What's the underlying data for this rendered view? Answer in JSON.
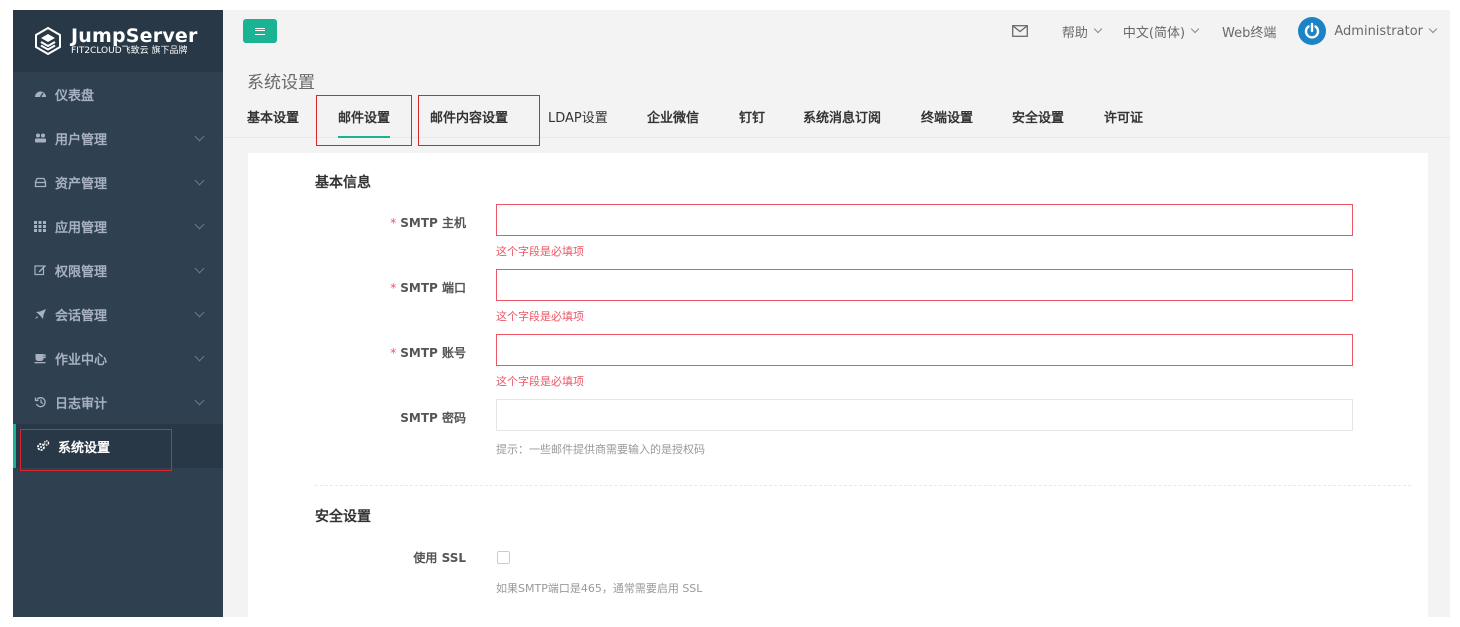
{
  "app": {
    "logo_title": "JumpServer",
    "logo_subtitle": "FIT2CLOUD飞致云 旗下品牌",
    "accent_color": "#1ab394",
    "sidebar_color": "#2f4050"
  },
  "sidebar": {
    "items": [
      {
        "label": "仪表盘",
        "icon": "dashboard-icon",
        "has_children": false
      },
      {
        "label": "用户管理",
        "icon": "users-icon",
        "has_children": true
      },
      {
        "label": "资产管理",
        "icon": "inbox-icon",
        "has_children": true
      },
      {
        "label": "应用管理",
        "icon": "grid-icon",
        "has_children": true
      },
      {
        "label": "权限管理",
        "icon": "edit-icon",
        "has_children": true
      },
      {
        "label": "会话管理",
        "icon": "rocket-icon",
        "has_children": true
      },
      {
        "label": "作业中心",
        "icon": "coffee-icon",
        "has_children": true
      },
      {
        "label": "日志审计",
        "icon": "history-icon",
        "has_children": true
      },
      {
        "label": "系统设置",
        "icon": "cogs-icon",
        "has_children": false,
        "active": true
      }
    ]
  },
  "topbar": {
    "menu_toggle_icon": "hamburger-icon",
    "mail_icon": "envelope-icon",
    "help": "帮助",
    "language": "中文(简体)",
    "web_terminal": "Web终端",
    "user": "Administrator"
  },
  "page": {
    "title": "系统设置",
    "tabs": [
      {
        "label": "基本设置"
      },
      {
        "label": "邮件设置",
        "active": true
      },
      {
        "label": "邮件内容设置"
      },
      {
        "label": "LDAP设置"
      },
      {
        "label": "企业微信"
      },
      {
        "label": "钉钉"
      },
      {
        "label": "系统消息订阅"
      },
      {
        "label": "终端设置"
      },
      {
        "label": "安全设置"
      },
      {
        "label": "许可证"
      }
    ]
  },
  "form": {
    "section_basic": "基本信息",
    "smtp_host": {
      "label": "SMTP 主机",
      "required_mark": "*",
      "value": "",
      "error": "这个字段是必填项"
    },
    "smtp_port": {
      "label": "SMTP 端口",
      "required_mark": "*",
      "value": "",
      "error": "这个字段是必填项"
    },
    "smtp_account": {
      "label": "SMTP 账号",
      "required_mark": "*",
      "value": "",
      "error": "这个字段是必填项"
    },
    "smtp_password": {
      "label": "SMTP 密码",
      "value": "",
      "help": "提示：一些邮件提供商需要输入的是授权码"
    },
    "section_security": "安全设置",
    "use_ssl": {
      "label": "使用 SSL",
      "checked": false,
      "help": "如果SMTP端口是465，通常需要启用 SSL"
    }
  }
}
